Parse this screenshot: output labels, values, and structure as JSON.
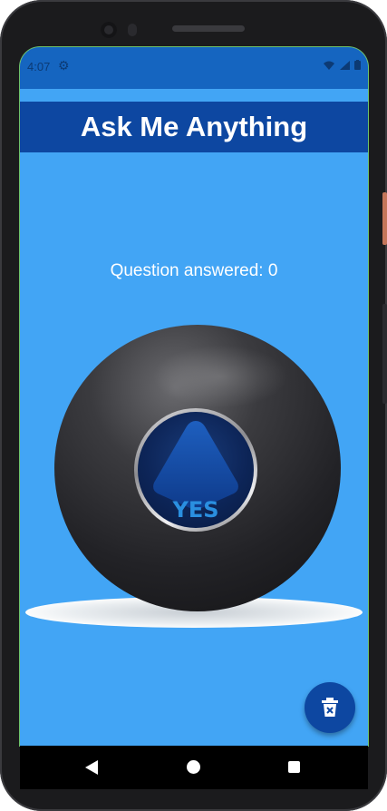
{
  "status_bar": {
    "time": "4:07",
    "settings_icon": "gear-icon",
    "wifi_icon": "wifi-icon",
    "signal_icon": "signal-icon",
    "battery_icon": "battery-icon"
  },
  "app_bar": {
    "title": "Ask Me Anything"
  },
  "counter": {
    "text": "Question answered: 0"
  },
  "magic_ball": {
    "answer": "YES",
    "image": "magic-8-ball"
  },
  "fab": {
    "icon": "delete-icon"
  },
  "nav_bar": {
    "back_icon": "back-icon",
    "home_icon": "home-icon",
    "recents_icon": "recents-icon"
  },
  "colors": {
    "background": "#42a5f5",
    "app_bar": "#0d47a1",
    "status_bar": "#1565c0",
    "answer_text": "#2a8fe0"
  }
}
